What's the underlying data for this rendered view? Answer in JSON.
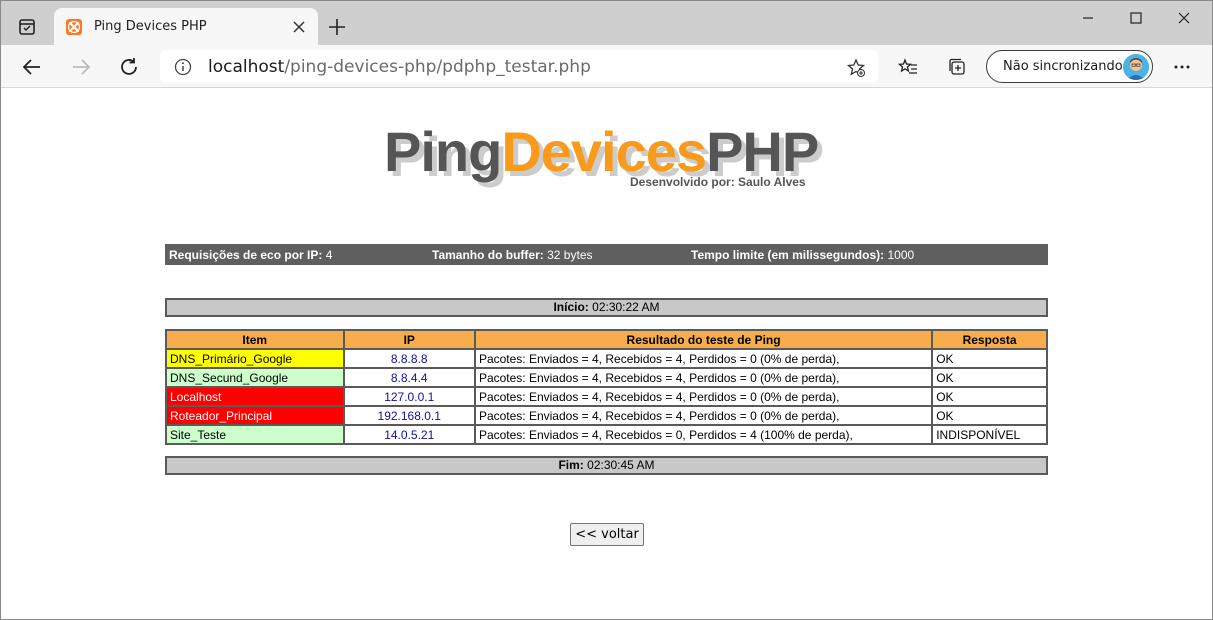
{
  "browser": {
    "tab_title": "Ping Devices PHP",
    "url_host": "localhost",
    "url_path": "/ping-devices-php/pdphp_testar.php",
    "profile_label": "Não sincronizando"
  },
  "logo": {
    "part1": "Ping",
    "part2": "Devices",
    "part3": "PHP",
    "subtitle": "Desenvolvido por: Saulo Alves"
  },
  "settings": {
    "echo_label": "Requisições de eco por IP:",
    "echo_value": "4",
    "buffer_label": "Tamanho do buffer:",
    "buffer_value": "32 bytes",
    "timeout_label": "Tempo limite (em milissegundos):",
    "timeout_value": "1000"
  },
  "start": {
    "label": "Início:",
    "time": "02:30:22 AM"
  },
  "end": {
    "label": "Fim:",
    "time": "02:30:45 AM"
  },
  "table": {
    "headers": [
      "Item",
      "IP",
      "Resultado do teste de Ping",
      "Resposta"
    ],
    "rows": [
      {
        "item": "DNS_Primário_Google",
        "ip": "8.8.8.8",
        "result": "Pacotes: Enviados = 4, Recebidos = 4, Perdidos = 0 (0% de perda),",
        "response": "OK"
      },
      {
        "item": "DNS_Secund_Google",
        "ip": "8.8.4.4",
        "result": "Pacotes: Enviados = 4, Recebidos = 4, Perdidos = 0 (0% de perda),",
        "response": "OK"
      },
      {
        "item": "Localhost",
        "ip": "127.0.0.1",
        "result": "Pacotes: Enviados = 4, Recebidos = 4, Perdidos = 0 (0% de perda),",
        "response": "OK"
      },
      {
        "item": "Roteador_Principal",
        "ip": "192.168.0.1",
        "result": "Pacotes: Enviados = 4, Recebidos = 4, Perdidos = 0 (0% de perda),",
        "response": "OK"
      },
      {
        "item": "Site_Teste",
        "ip": "14.0.5.21",
        "result": "Pacotes: Enviados = 4, Recebidos = 0, Perdidos = 4 (100% de perda),",
        "response": "INDISPONÍVEL"
      }
    ]
  },
  "back_button": "<< voltar",
  "colors": {
    "header_orange": "#f8ad4c",
    "logo_orange": "#f89a1c",
    "row_yellow": "#ffff00",
    "row_green": "#ccffcc",
    "row_red": "#ff0000",
    "infobar_gray": "#5f5f5f"
  }
}
